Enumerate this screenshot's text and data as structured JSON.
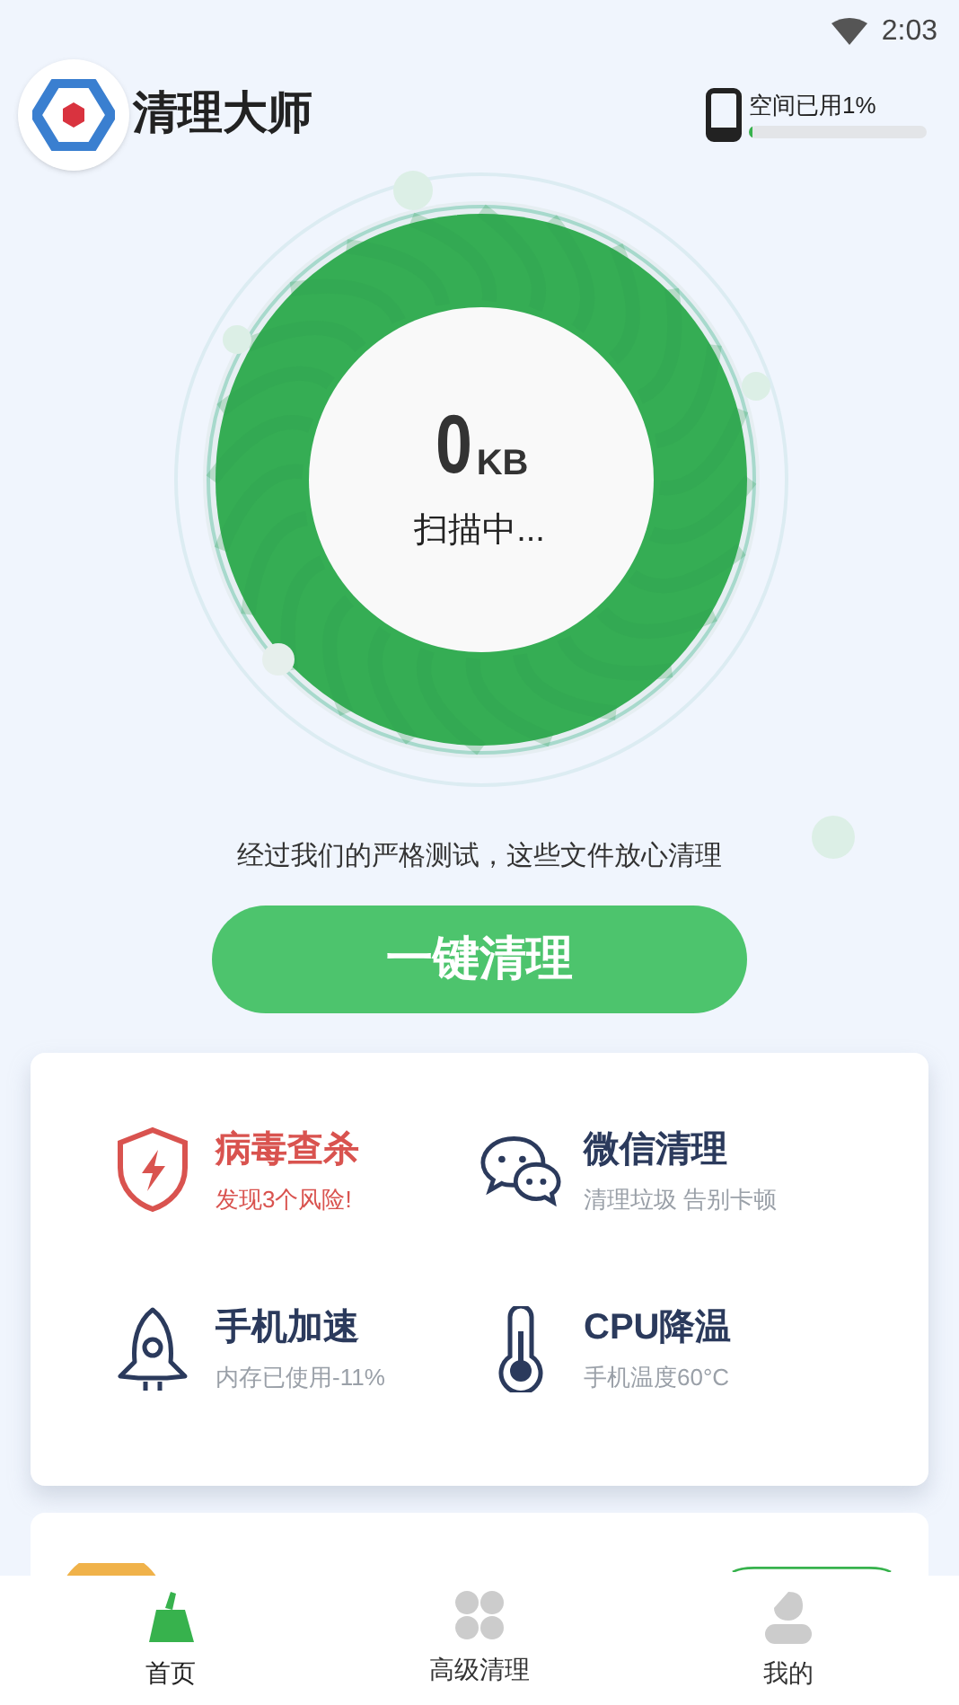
{
  "status_bar": {
    "time": "2:03"
  },
  "header": {
    "title": "清理大师",
    "storage": {
      "label": "空间已用1%",
      "level": 0.01
    }
  },
  "scan": {
    "size": "0",
    "unit": "KB",
    "status": "扫描中..."
  },
  "caption": "经过我们的严格测试，这些文件放心清理",
  "clean_button": "一键清理",
  "features": [
    {
      "kind": "shield",
      "title": "病毒查杀",
      "subtitle": "发现3个风险!",
      "alert": true
    },
    {
      "kind": "chat",
      "title": "微信清理",
      "subtitle": "清理垃圾 告别卡顿",
      "alert": false
    },
    {
      "kind": "rocket",
      "title": "手机加速",
      "subtitle": "内存已使用-11%",
      "alert": false
    },
    {
      "kind": "thermometer",
      "title": "CPU降温",
      "subtitle": "手机温度60°C",
      "alert": false
    }
  ],
  "nav": [
    {
      "kind": "broom",
      "label": "首页",
      "selected": true
    },
    {
      "kind": "grid",
      "label": "高级清理",
      "selected": false
    },
    {
      "kind": "person",
      "label": "我的",
      "selected": false
    }
  ]
}
